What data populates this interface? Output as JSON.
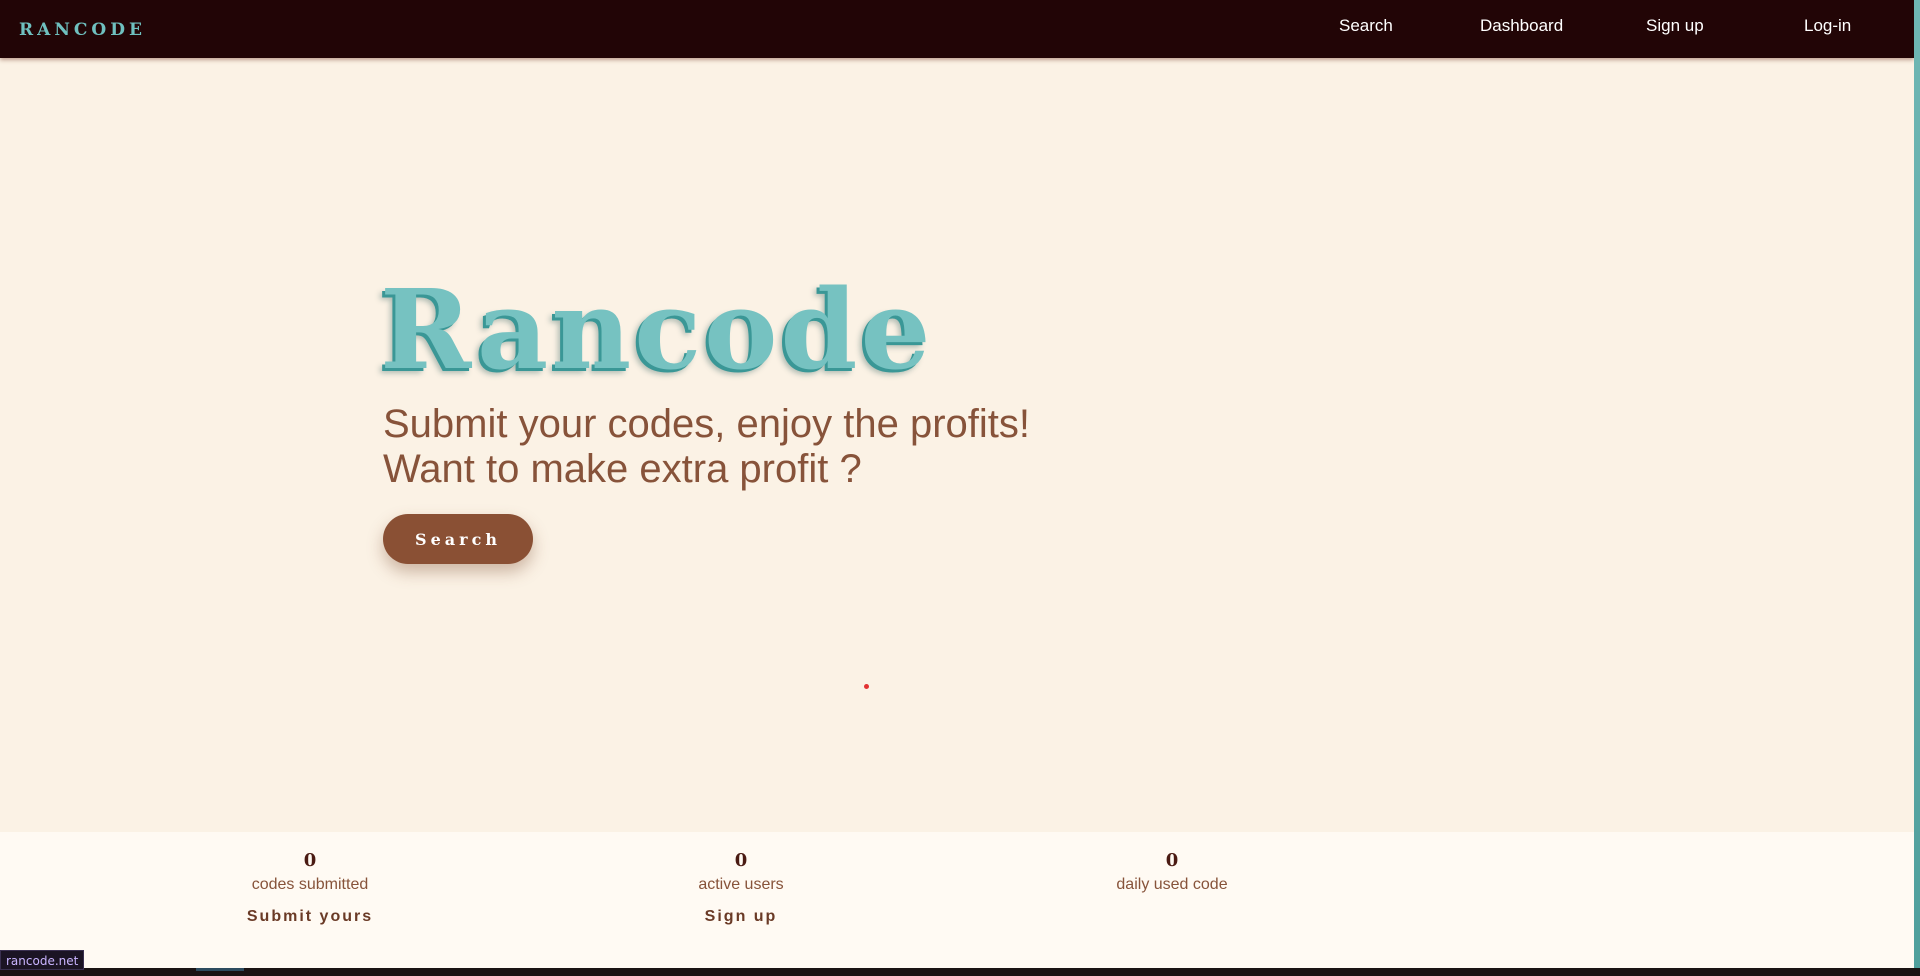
{
  "navbar": {
    "brand": "RANCODE",
    "links": [
      "Search",
      "Dashboard",
      "Sign up",
      "Log-in"
    ]
  },
  "hero": {
    "title": "Rancode",
    "line1": "Submit your codes, enjoy the profits!",
    "line2": "Want to make extra profit ?",
    "button": "Search"
  },
  "stats": [
    {
      "value": "0",
      "label": "codes submitted",
      "link": "Submit yours"
    },
    {
      "value": "0",
      "label": "active users",
      "link": "Sign up"
    },
    {
      "value": "0",
      "label": "daily used code",
      "link": ""
    }
  ],
  "status_bar": {
    "url": "rancode.net"
  },
  "colors": {
    "navbar_bg": "#220506",
    "page_bg": "#fbf2e5",
    "accent_teal": "#76c2c1",
    "accent_brown": "#8a5034"
  }
}
